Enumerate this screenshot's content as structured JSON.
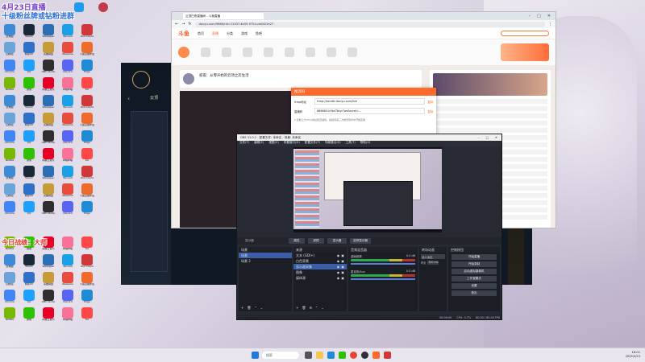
{
  "overlay": {
    "line1": "4月23日直播",
    "line2": "十级粉丝牌或钻粉进群",
    "line3": "今日战绩：大师"
  },
  "desktop_icons": [
    {
      "label": "此电脑",
      "color": "#3b8bd9"
    },
    {
      "label": "Steam",
      "color": "#1b2838"
    },
    {
      "label": "Wallpaper",
      "color": "#2c6fb5"
    },
    {
      "label": "Tencent",
      "color": "#1aa0e6"
    },
    {
      "label": "Riot Client",
      "color": "#d13639"
    },
    {
      "label": "回收站",
      "color": "#6aa4d8"
    },
    {
      "label": "网易UU",
      "color": "#2f71c9"
    },
    {
      "label": "英雄联盟",
      "color": "#c69b3a"
    },
    {
      "label": "WeGame",
      "color": "#e94c3d"
    },
    {
      "label": "斗鱼直播伴侣",
      "color": "#ef6b2b"
    },
    {
      "label": "Chrome",
      "color": "#4285f4"
    },
    {
      "label": "QQ",
      "color": "#1ea0ff"
    },
    {
      "label": "OBS Studio",
      "color": "#302e31"
    },
    {
      "label": "Discord",
      "color": "#5865f2"
    },
    {
      "label": "Edge",
      "color": "#1f8ad6"
    },
    {
      "label": "NVIDIA",
      "color": "#76b900"
    },
    {
      "label": "微信",
      "color": "#2dc100"
    },
    {
      "label": "网易云音乐",
      "color": "#e60026"
    },
    {
      "label": "哔哩哔哩",
      "color": "#fb7299"
    },
    {
      "label": "EA",
      "color": "#ff4747"
    }
  ],
  "browser": {
    "tab_title": "云顶白夜直播间 - 斗鱼直播",
    "url": "douyu.com/9666/rid=1243?-4b55-9754-cb6422e27",
    "site_logo": "斗鱼",
    "nav": [
      "首页",
      "直播",
      "分类",
      "游戏",
      "鱼吧"
    ],
    "stream_title": "初夜：从零开始的云顶之弈生活",
    "modal_title": "推流码",
    "modal_rows": [
      {
        "label": "rtmp地址",
        "value": "rtmp://sendtc.douyu.com/live",
        "action": "复制"
      },
      {
        "label": "直播码",
        "value": "8666601rVbxTbtyr?wsSecret=...",
        "action": "复制"
      }
    ],
    "modal_note": "1.复制上方rtmp地址和直播码，粘贴到第三方推流软件中开始直播"
  },
  "game_panel": {
    "title": "云顶"
  },
  "obs": {
    "title": "OBS 31.0.2 - 配置文件: 未命名 - 场景: 未命名",
    "menu": [
      "文件(F)",
      "编辑(E)",
      "视图(V)",
      "停靠窗口(D)",
      "配置文件(P)",
      "场景集合(S)",
      "工具(T)",
      "帮助(H)"
    ],
    "source_toolbar": [
      "属性",
      "滤镜",
      "显示器",
      "选择显示器"
    ],
    "panels": {
      "scenes": "场景",
      "sources": "来源",
      "mixer": "音频混音器",
      "transitions": "转场动画",
      "controls": "控制按钮"
    },
    "scenes": [
      "场景",
      "场景 2"
    ],
    "sources": [
      "文本 (GDI+)",
      "白色背景",
      "显示器采集",
      "图像",
      "媒体源"
    ],
    "mixer": [
      {
        "name": "桌面音频",
        "db": "0.0 dB"
      },
      {
        "name": "麦克风/Aux",
        "db": "0.0 dB"
      }
    ],
    "transition": {
      "type": "淡入淡出",
      "duration_label": "时长",
      "duration": "300 ms"
    },
    "controls": [
      "开始直播",
      "开始录制",
      "启动虚拟摄像机",
      "工作室模式",
      "设置",
      "退出"
    ],
    "status": {
      "cpu": "CPU: 0.7%",
      "fps": "60.00 / 60.00 FPS",
      "time": "00:00:00"
    }
  },
  "taskbar": {
    "search_placeholder": "搜索",
    "time": "18:01",
    "date": "2025/4/23"
  }
}
